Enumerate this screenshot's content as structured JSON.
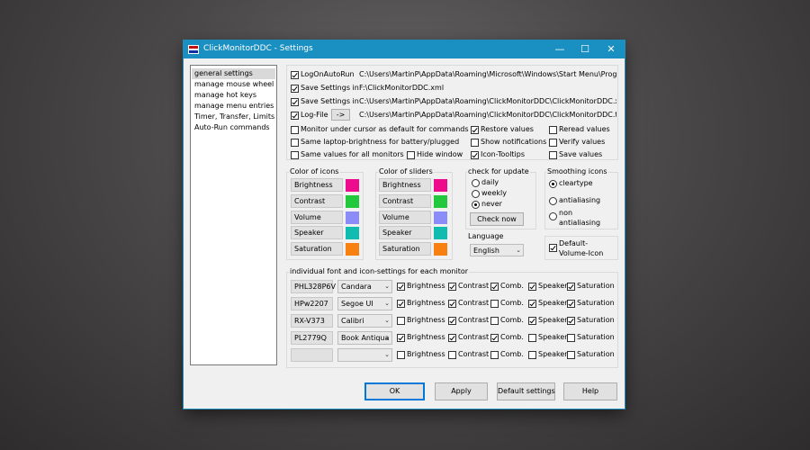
{
  "window": {
    "title": "ClickMonitorDDC - Settings"
  },
  "nav": {
    "items": [
      "general settings",
      "manage mouse wheel",
      "manage hot keys",
      "manage menu entries",
      "Timer, Transfer, Limits",
      "Auto-Run commands"
    ]
  },
  "general": {
    "logon_autorun": {
      "label": "LogOnAutoRun",
      "checked": true,
      "path": "C:\\Users\\MartinP\\AppData\\Roaming\\Microsoft\\Windows\\Start Menu\\Programs\\S"
    },
    "save_settings_1": {
      "label": "Save Settings in",
      "checked": true,
      "path": "F:\\ClickMonitorDDC.xml"
    },
    "save_settings_2": {
      "label": "Save Settings in",
      "checked": true,
      "path": "C:\\Users\\MartinP\\AppData\\Roaming\\ClickMonitorDDC\\ClickMonitorDDC.xml"
    },
    "log_file": {
      "label": "Log-File",
      "checked": true,
      "button": "->",
      "path": "C:\\Users\\MartinP\\AppData\\Roaming\\ClickMonitorDDC\\ClickMonitorDDC.txt"
    },
    "monitor_under_cursor": {
      "label": "Monitor under cursor as default for commands",
      "checked": false
    },
    "same_laptop_brightness": {
      "label": "Same laptop-brightness for battery/plugged",
      "checked": false
    },
    "same_values_all": {
      "label": "Same values for all monitors",
      "checked": false
    },
    "hide_window": {
      "label": "Hide window",
      "checked": false
    },
    "restore_values": {
      "label": "Restore values",
      "checked": true
    },
    "show_notifications": {
      "label": "Show notifications",
      "checked": false
    },
    "icon_tooltips": {
      "label": "Icon-Tooltips",
      "checked": true
    },
    "reread_values": {
      "label": "Reread values",
      "checked": false
    },
    "verify_values": {
      "label": "Verify values",
      "checked": false
    },
    "save_values": {
      "label": "Save values",
      "checked": false
    }
  },
  "icon_colors": {
    "title": "Color of icons",
    "items": [
      {
        "label": "Brightness",
        "color": "#ec0c8c"
      },
      {
        "label": "Contrast",
        "color": "#22c83c"
      },
      {
        "label": "Volume",
        "color": "#8c8cf8"
      },
      {
        "label": "Speaker",
        "color": "#10bcb0"
      },
      {
        "label": "Saturation",
        "color": "#f88010"
      }
    ]
  },
  "slider_colors": {
    "title": "Color of sliders",
    "items": [
      {
        "label": "Brightness",
        "color": "#ec0c8c"
      },
      {
        "label": "Contrast",
        "color": "#22c83c"
      },
      {
        "label": "Volume",
        "color": "#8c8cf8"
      },
      {
        "label": "Speaker",
        "color": "#10bcb0"
      },
      {
        "label": "Saturation",
        "color": "#f88010"
      }
    ]
  },
  "update": {
    "title": "check for update",
    "options": [
      "daily",
      "weekly",
      "never"
    ],
    "selected": "never",
    "button": "Check now"
  },
  "smoothing": {
    "title": "Smoothing icons",
    "options": [
      "cleartype",
      "antialiasing",
      "non antialiasing"
    ],
    "selected": "cleartype"
  },
  "language": {
    "title": "Language",
    "value": "English"
  },
  "default_volume": {
    "label": "Default-Volume-Icon",
    "checked": true
  },
  "monitors": {
    "title": "individual font and icon-settings for each monitor",
    "columns": [
      "Brightness",
      "Contrast",
      "Comb.",
      "Speaker",
      "Saturation"
    ],
    "rows": [
      {
        "name": "PHL328P6V",
        "font": "Candara",
        "checks": [
          true,
          true,
          true,
          true,
          true
        ]
      },
      {
        "name": "HPw2207",
        "font": "Segoe UI",
        "checks": [
          true,
          true,
          false,
          true,
          true
        ]
      },
      {
        "name": "RX-V373",
        "font": "Calibri",
        "checks": [
          false,
          true,
          false,
          true,
          true
        ]
      },
      {
        "name": "PL2779Q",
        "font": "Book Antiqua",
        "checks": [
          true,
          true,
          true,
          false,
          false
        ]
      },
      {
        "name": "",
        "font": "",
        "checks": [
          false,
          false,
          false,
          false,
          false
        ]
      }
    ]
  },
  "buttons": {
    "ok": "OK",
    "apply": "Apply",
    "defaults": "Default settings",
    "help": "Help"
  }
}
